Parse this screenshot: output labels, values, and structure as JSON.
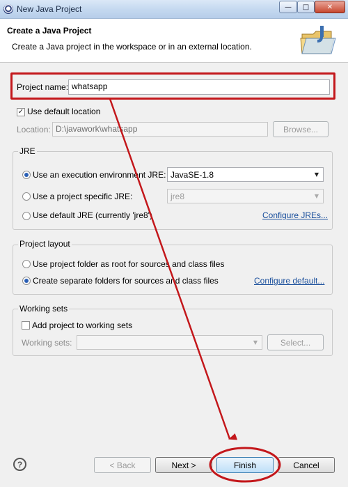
{
  "window": {
    "title": "New Java Project",
    "minimize_symbol": "—",
    "maximize_symbol": "□",
    "close_symbol": "✕"
  },
  "banner": {
    "title": "Create a Java Project",
    "description": "Create a Java project in the workspace or in an external location.",
    "icon": "folder-java-icon"
  },
  "project": {
    "name_label": "Project name:",
    "name_value": "whatsapp",
    "use_default_location_label": "Use default location",
    "use_default_location_checked": true,
    "location_label": "Location:",
    "location_value": "D:\\javawork\\whatsapp",
    "browse_label": "Browse..."
  },
  "jre": {
    "group_title": "JRE",
    "option_execution_env_label": "Use an execution environment JRE:",
    "execution_env_value": "JavaSE-1.8",
    "option_project_specific_label": "Use a project specific JRE:",
    "project_specific_value": "jre8",
    "option_default_label": "Use default JRE (currently 'jre8')",
    "configure_link": "Configure JREs...",
    "selected_option": "execution-environment"
  },
  "layout": {
    "group_title": "Project layout",
    "option_root_label": "Use project folder as root for sources and class files",
    "option_separate_label": "Create separate folders for sources and class files",
    "configure_link": "Configure default...",
    "selected_option": "separate"
  },
  "working_sets": {
    "group_title": "Working sets",
    "add_label": "Add project to working sets",
    "add_checked": false,
    "sets_label": "Working sets:",
    "sets_value": "",
    "select_label": "Select..."
  },
  "footer": {
    "help_symbol": "?",
    "back_label": "< Back",
    "next_label": "Next >",
    "finish_label": "Finish",
    "cancel_label": "Cancel"
  },
  "annotation": {
    "color": "#c3171b"
  }
}
